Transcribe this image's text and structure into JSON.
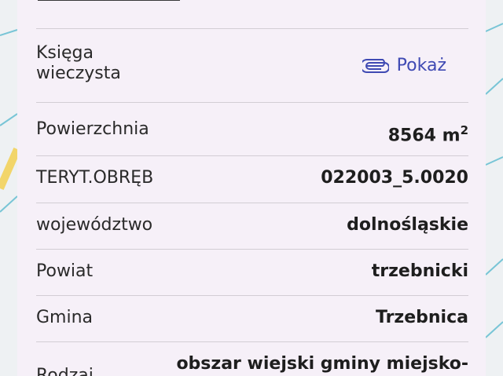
{
  "header": {
    "cut_title": "───────────────"
  },
  "rows": [
    {
      "label": "Księga\nwieczysta",
      "link_label": "Pokaż"
    },
    {
      "label": "Powierzchnia",
      "value": "8564 m",
      "unit_sup": "2"
    },
    {
      "label": "TERYT.OBRĘB",
      "value": "022003_5.0020"
    },
    {
      "label": "województwo",
      "value": "dolnośląskie"
    },
    {
      "label": "Powiat",
      "value": "trzebnicki"
    },
    {
      "label": "Gmina",
      "value": "Trzebnica"
    },
    {
      "label": "Rodzaj",
      "value": "obszar wiejski gminy miejsko-"
    }
  ],
  "icons": {
    "attachment": "paperclip-icon"
  },
  "colors": {
    "sheet_bg": "#f6f0f8",
    "link": "#3f4ab3",
    "divider": "#d2cdd4"
  }
}
